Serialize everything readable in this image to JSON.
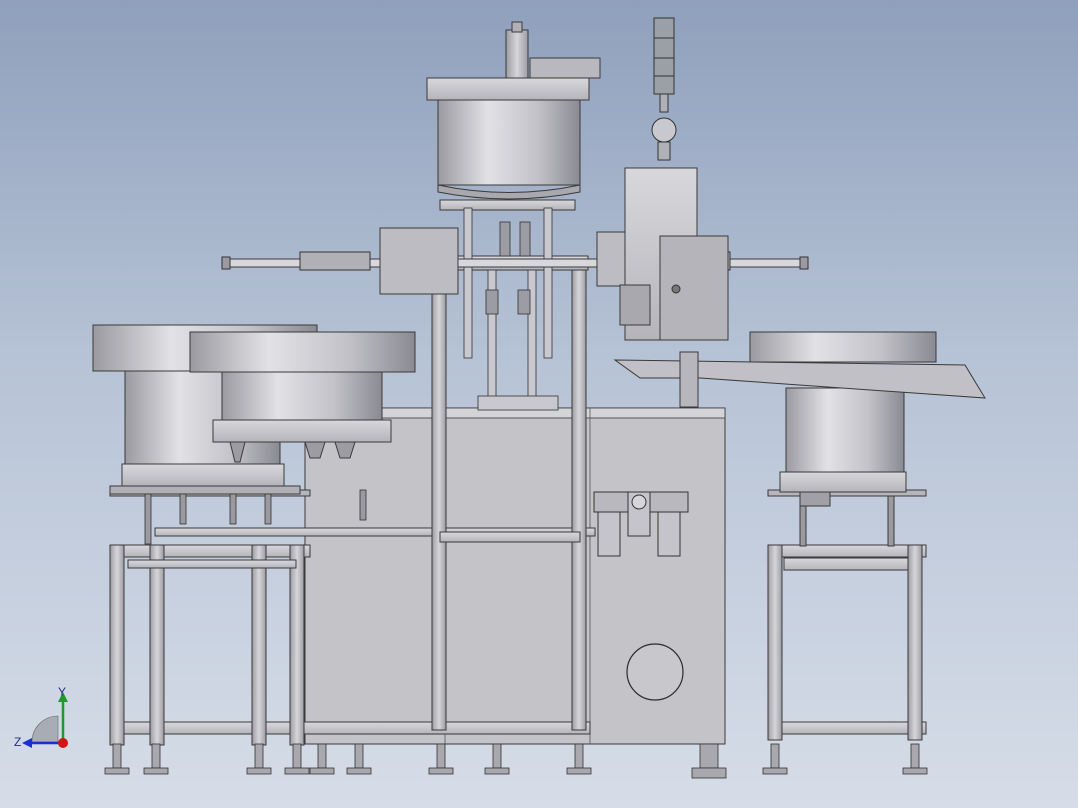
{
  "viewport": {
    "background_top": "#8fa0bc",
    "background_bottom": "#d6dde8"
  },
  "triad": {
    "y_label": "Y",
    "z_label": "Z",
    "x_color": "#d11414",
    "y_color": "#1f9a2a",
    "z_color": "#1a2fd6"
  },
  "model": {
    "metal_light": "#d4d4d8",
    "metal_mid": "#b8b8bd",
    "metal_dark": "#8d8d93",
    "outline": "#3a3a3a"
  }
}
